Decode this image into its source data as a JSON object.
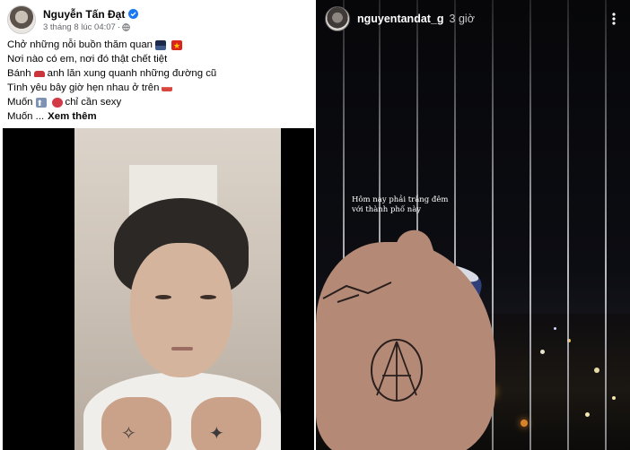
{
  "facebook_post": {
    "author_name": "Nguyễn Tấn Đạt",
    "verified": true,
    "timestamp": "3 tháng 8 lúc 04:07",
    "separator": "·",
    "caption_lines": [
      "Chở những nỗi buồn thăm quan",
      "Nơi nào có em, nơi đó thật chết tiệt",
      "Bánh",
      "anh lăn xung quanh những đường cũ",
      "Tình yêu bây giờ hẹn nhau ở trên",
      "Muốn",
      "chỉ cần sexy",
      "Muốn ..."
    ],
    "see_more_label": "Xem thêm",
    "icons": {
      "verified": "verified-badge-icon",
      "privacy": "globe-icon"
    }
  },
  "story": {
    "username": "nguyentandat_g",
    "time_ago": "3 giờ",
    "overlay_text_line1": "Hôm nay phải trắng đêm",
    "overlay_text_line2": "với thành phố này",
    "icons": {
      "more": "more-vertical-icon"
    }
  },
  "colors": {
    "fb_blue": "#1877f2",
    "text_primary": "#050505",
    "text_secondary": "#65676b",
    "story_bg": "#0c0d12"
  }
}
